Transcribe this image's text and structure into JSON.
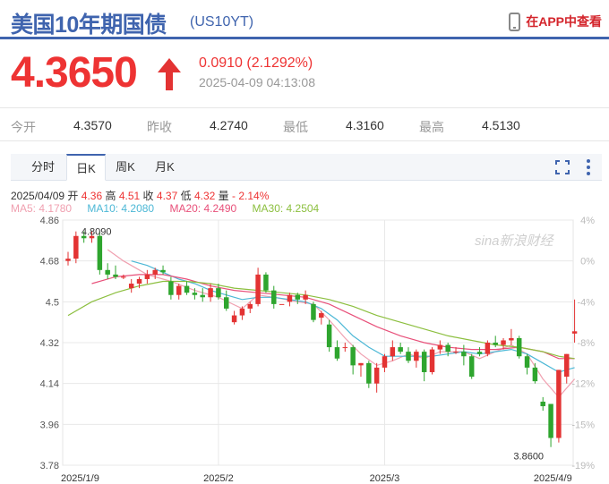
{
  "header": {
    "title": "美国10年期国债",
    "code": "(US10YT)",
    "app_link": "在APP中查看"
  },
  "quote": {
    "price": "4.3650",
    "direction": "up",
    "change": "0.0910 (2.1292%)",
    "time": "2025-04-09 04:13:08"
  },
  "stats": [
    {
      "label": "今开",
      "value": "4.3570"
    },
    {
      "label": "昨收",
      "value": "4.2740"
    },
    {
      "label": "最低",
      "value": "4.3160"
    },
    {
      "label": "最高",
      "value": "4.5130"
    }
  ],
  "tabs": [
    {
      "label": "分时",
      "active": false
    },
    {
      "label": "日K",
      "active": true
    },
    {
      "label": "周K",
      "active": false
    },
    {
      "label": "月K",
      "active": false
    }
  ],
  "candle_info": {
    "date": "2025/04/09",
    "open_label": "开",
    "open": "4.36",
    "high_label": "高",
    "high": "4.51",
    "close_label": "收",
    "close": "4.37",
    "low_label": "低",
    "low": "4.32",
    "change_label": "量",
    "change": "- 2.14%"
  },
  "ma_info": [
    {
      "text": "MA5: 4.1780",
      "color": "#f0a0b0"
    },
    {
      "text": "MA10: 4.2080",
      "color": "#4db8d6"
    },
    {
      "text": "MA20: 4.2490",
      "color": "#e8507a"
    },
    {
      "text": "MA30: 4.2504",
      "color": "#8cbf3f"
    }
  ],
  "watermark": "sina新浪财经",
  "colors": {
    "up": "#e33333",
    "down": "#2ea52e",
    "accent": "#3f64ae",
    "grid": "#e8e8e8"
  },
  "chart_data": {
    "type": "candlestick",
    "y_ticks": [
      "4.86",
      "4.68",
      "4.5",
      "4.32",
      "4.14",
      "3.96",
      "3.78"
    ],
    "ylim": [
      3.78,
      4.86
    ],
    "pct_ticks": [
      "4%",
      "0%",
      "-4%",
      "-8%",
      "-12%",
      "-15%",
      "-19%"
    ],
    "x_labels": [
      "2025/1/9",
      "2025/2",
      "2025/3",
      "2025/4/9"
    ],
    "x_label_index": [
      0,
      19,
      40,
      63
    ],
    "max_label": "4.8090",
    "min_label": "3.8600",
    "candles": [
      {
        "o": 4.68,
        "h": 4.72,
        "l": 4.66,
        "c": 4.69
      },
      {
        "o": 4.69,
        "h": 4.81,
        "l": 4.67,
        "c": 4.79
      },
      {
        "o": 4.79,
        "h": 4.81,
        "l": 4.76,
        "c": 4.78
      },
      {
        "o": 4.78,
        "h": 4.81,
        "l": 4.76,
        "c": 4.79
      },
      {
        "o": 4.79,
        "h": 4.81,
        "l": 4.62,
        "c": 4.64
      },
      {
        "o": 4.64,
        "h": 4.67,
        "l": 4.6,
        "c": 4.62
      },
      {
        "o": 4.62,
        "h": 4.66,
        "l": 4.6,
        "c": 4.61
      },
      {
        "o": 4.61,
        "h": 4.62,
        "l": 4.6,
        "c": 4.61
      },
      {
        "o": 4.56,
        "h": 4.6,
        "l": 4.54,
        "c": 4.58
      },
      {
        "o": 4.58,
        "h": 4.61,
        "l": 4.56,
        "c": 4.6
      },
      {
        "o": 4.6,
        "h": 4.64,
        "l": 4.58,
        "c": 4.62
      },
      {
        "o": 4.62,
        "h": 4.65,
        "l": 4.6,
        "c": 4.64
      },
      {
        "o": 4.64,
        "h": 4.66,
        "l": 4.62,
        "c": 4.63
      },
      {
        "o": 4.59,
        "h": 4.61,
        "l": 4.51,
        "c": 4.53
      },
      {
        "o": 4.53,
        "h": 4.58,
        "l": 4.51,
        "c": 4.57
      },
      {
        "o": 4.57,
        "h": 4.59,
        "l": 4.53,
        "c": 4.54
      },
      {
        "o": 4.54,
        "h": 4.56,
        "l": 4.51,
        "c": 4.53
      },
      {
        "o": 4.53,
        "h": 4.56,
        "l": 4.5,
        "c": 4.52
      },
      {
        "o": 4.52,
        "h": 4.58,
        "l": 4.5,
        "c": 4.56
      },
      {
        "o": 4.56,
        "h": 4.58,
        "l": 4.51,
        "c": 4.52
      },
      {
        "o": 4.52,
        "h": 4.55,
        "l": 4.46,
        "c": 4.47
      },
      {
        "o": 4.41,
        "h": 4.46,
        "l": 4.4,
        "c": 4.44
      },
      {
        "o": 4.44,
        "h": 4.48,
        "l": 4.42,
        "c": 4.47
      },
      {
        "o": 4.47,
        "h": 4.5,
        "l": 4.45,
        "c": 4.49
      },
      {
        "o": 4.49,
        "h": 4.65,
        "l": 4.48,
        "c": 4.62
      },
      {
        "o": 4.62,
        "h": 4.63,
        "l": 4.54,
        "c": 4.55
      },
      {
        "o": 4.55,
        "h": 4.57,
        "l": 4.47,
        "c": 4.49
      },
      {
        "o": 4.49,
        "h": 4.49,
        "l": 4.49,
        "c": 4.49
      },
      {
        "o": 4.5,
        "h": 4.54,
        "l": 4.48,
        "c": 4.53
      },
      {
        "o": 4.53,
        "h": 4.54,
        "l": 4.49,
        "c": 4.51
      },
      {
        "o": 4.51,
        "h": 4.55,
        "l": 4.49,
        "c": 4.53
      },
      {
        "o": 4.49,
        "h": 4.5,
        "l": 4.41,
        "c": 4.42
      },
      {
        "o": 4.43,
        "h": 4.46,
        "l": 4.4,
        "c": 4.45
      },
      {
        "o": 4.4,
        "h": 4.42,
        "l": 4.28,
        "c": 4.3
      },
      {
        "o": 4.3,
        "h": 4.33,
        "l": 4.24,
        "c": 4.25
      },
      {
        "o": 4.3,
        "h": 4.32,
        "l": 4.28,
        "c": 4.3
      },
      {
        "o": 4.3,
        "h": 4.31,
        "l": 4.18,
        "c": 4.22
      },
      {
        "o": 4.22,
        "h": 4.23,
        "l": 4.17,
        "c": 4.23
      },
      {
        "o": 4.23,
        "h": 4.24,
        "l": 4.12,
        "c": 4.14
      },
      {
        "o": 4.14,
        "h": 4.23,
        "l": 4.1,
        "c": 4.21
      },
      {
        "o": 4.21,
        "h": 4.27,
        "l": 4.19,
        "c": 4.26
      },
      {
        "o": 4.26,
        "h": 4.33,
        "l": 4.24,
        "c": 4.3
      },
      {
        "o": 4.3,
        "h": 4.32,
        "l": 4.27,
        "c": 4.28
      },
      {
        "o": 4.28,
        "h": 4.3,
        "l": 4.23,
        "c": 4.24
      },
      {
        "o": 4.24,
        "h": 4.29,
        "l": 4.21,
        "c": 4.28
      },
      {
        "o": 4.28,
        "h": 4.29,
        "l": 4.15,
        "c": 4.19
      },
      {
        "o": 4.19,
        "h": 4.3,
        "l": 4.18,
        "c": 4.29
      },
      {
        "o": 4.29,
        "h": 4.33,
        "l": 4.27,
        "c": 4.31
      },
      {
        "o": 4.31,
        "h": 4.32,
        "l": 4.26,
        "c": 4.28
      },
      {
        "o": 4.28,
        "h": 4.3,
        "l": 4.27,
        "c": 4.28
      },
      {
        "o": 4.28,
        "h": 4.31,
        "l": 4.22,
        "c": 4.26
      },
      {
        "o": 4.26,
        "h": 4.27,
        "l": 4.16,
        "c": 4.17
      },
      {
        "o": 4.28,
        "h": 4.3,
        "l": 4.26,
        "c": 4.27
      },
      {
        "o": 4.27,
        "h": 4.33,
        "l": 4.26,
        "c": 4.32
      },
      {
        "o": 4.32,
        "h": 4.35,
        "l": 4.3,
        "c": 4.31
      },
      {
        "o": 4.31,
        "h": 4.34,
        "l": 4.29,
        "c": 4.33
      },
      {
        "o": 4.33,
        "h": 4.38,
        "l": 4.31,
        "c": 4.34
      },
      {
        "o": 4.34,
        "h": 4.35,
        "l": 4.25,
        "c": 4.26
      },
      {
        "o": 4.26,
        "h": 4.27,
        "l": 4.18,
        "c": 4.21
      },
      {
        "o": 4.21,
        "h": 4.23,
        "l": 4.14,
        "c": 4.15
      },
      {
        "o": 4.06,
        "h": 4.08,
        "l": 4.02,
        "c": 4.04
      },
      {
        "o": 4.05,
        "h": 4.05,
        "l": 3.86,
        "c": 3.9
      },
      {
        "o": 3.9,
        "h": 4.2,
        "l": 3.88,
        "c": 4.2
      },
      {
        "o": 4.17,
        "h": 4.27,
        "l": 4.14,
        "c": 4.27
      },
      {
        "o": 4.36,
        "h": 4.51,
        "l": 4.32,
        "c": 4.37
      }
    ],
    "ma_series": [
      {
        "name": "MA5",
        "color": "#f0a0b0",
        "points": [
          [
            5,
            4.73
          ],
          [
            7,
            4.68
          ],
          [
            10,
            4.62
          ],
          [
            13,
            4.59
          ],
          [
            16,
            4.55
          ],
          [
            19,
            4.52
          ],
          [
            22,
            4.47
          ],
          [
            24,
            4.53
          ],
          [
            26,
            4.52
          ],
          [
            29,
            4.5
          ],
          [
            31,
            4.49
          ],
          [
            33,
            4.42
          ],
          [
            35,
            4.34
          ],
          [
            37,
            4.27
          ],
          [
            39,
            4.22
          ],
          [
            41,
            4.24
          ],
          [
            43,
            4.27
          ],
          [
            45,
            4.25
          ],
          [
            47,
            4.28
          ],
          [
            50,
            4.28
          ],
          [
            52,
            4.25
          ],
          [
            54,
            4.28
          ],
          [
            56,
            4.31
          ],
          [
            58,
            4.27
          ],
          [
            60,
            4.16
          ],
          [
            62,
            4.08
          ],
          [
            64,
            4.16
          ]
        ]
      },
      {
        "name": "MA10",
        "color": "#4db8d6",
        "points": [
          [
            8,
            4.68
          ],
          [
            10,
            4.66
          ],
          [
            12,
            4.63
          ],
          [
            14,
            4.6
          ],
          [
            16,
            4.58
          ],
          [
            18,
            4.55
          ],
          [
            20,
            4.53
          ],
          [
            22,
            4.51
          ],
          [
            24,
            4.52
          ],
          [
            26,
            4.52
          ],
          [
            28,
            4.51
          ],
          [
            30,
            4.5
          ],
          [
            32,
            4.47
          ],
          [
            34,
            4.42
          ],
          [
            36,
            4.35
          ],
          [
            38,
            4.3
          ],
          [
            40,
            4.26
          ],
          [
            42,
            4.26
          ],
          [
            44,
            4.26
          ],
          [
            46,
            4.26
          ],
          [
            48,
            4.27
          ],
          [
            50,
            4.28
          ],
          [
            52,
            4.27
          ],
          [
            54,
            4.28
          ],
          [
            56,
            4.29
          ],
          [
            58,
            4.27
          ],
          [
            60,
            4.23
          ],
          [
            62,
            4.19
          ],
          [
            64,
            4.21
          ]
        ]
      },
      {
        "name": "MA20",
        "color": "#e8507a",
        "points": [
          [
            3,
            4.58
          ],
          [
            6,
            4.61
          ],
          [
            9,
            4.62
          ],
          [
            12,
            4.62
          ],
          [
            15,
            4.6
          ],
          [
            18,
            4.57
          ],
          [
            21,
            4.55
          ],
          [
            24,
            4.54
          ],
          [
            27,
            4.53
          ],
          [
            30,
            4.52
          ],
          [
            33,
            4.49
          ],
          [
            36,
            4.44
          ],
          [
            39,
            4.39
          ],
          [
            42,
            4.35
          ],
          [
            45,
            4.32
          ],
          [
            48,
            4.3
          ],
          [
            51,
            4.29
          ],
          [
            54,
            4.29
          ],
          [
            57,
            4.3
          ],
          [
            60,
            4.28
          ],
          [
            62,
            4.25
          ],
          [
            64,
            4.25
          ]
        ]
      },
      {
        "name": "MA30",
        "color": "#8cbf3f",
        "points": [
          [
            0,
            4.44
          ],
          [
            3,
            4.5
          ],
          [
            6,
            4.54
          ],
          [
            9,
            4.57
          ],
          [
            12,
            4.59
          ],
          [
            15,
            4.59
          ],
          [
            18,
            4.58
          ],
          [
            21,
            4.56
          ],
          [
            24,
            4.55
          ],
          [
            27,
            4.54
          ],
          [
            30,
            4.53
          ],
          [
            33,
            4.51
          ],
          [
            36,
            4.48
          ],
          [
            39,
            4.44
          ],
          [
            42,
            4.41
          ],
          [
            45,
            4.38
          ],
          [
            48,
            4.35
          ],
          [
            51,
            4.33
          ],
          [
            54,
            4.31
          ],
          [
            57,
            4.3
          ],
          [
            60,
            4.28
          ],
          [
            62,
            4.26
          ],
          [
            64,
            4.25
          ]
        ]
      }
    ]
  }
}
